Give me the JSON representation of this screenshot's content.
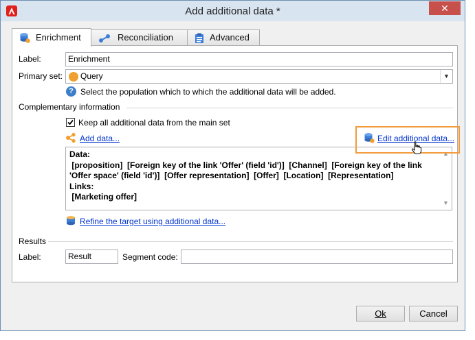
{
  "window": {
    "title": "Add additional data *",
    "close_label": "✕"
  },
  "tabs": [
    {
      "label": "Enrichment",
      "icon": "database-star-icon"
    },
    {
      "label": "Reconciliation",
      "icon": "link-nodes-icon"
    },
    {
      "label": "Advanced",
      "icon": "clipboard-icon"
    }
  ],
  "form": {
    "label_caption": "Label:",
    "label_value": "Enrichment",
    "primary_set_caption": "Primary set:",
    "primary_set_value": "Query",
    "help_text": "Select the population which to which the additional data will be added."
  },
  "complementary": {
    "section_title": "Complementary information",
    "keep_all_label": "Keep all additional data from the main set",
    "keep_all_checked": true,
    "add_data_link": "Add data...",
    "edit_data_link": "Edit additional data...",
    "data_lines": [
      "Data:",
      " [proposition]  [Foreign key of the link 'Offer' (field 'id')]  [Channel]  [Foreign key of the link 'Offer space' (field 'id')]  [Offer representation]  [Offer]  [Location]  [Representation]",
      "Links:",
      " [Marketing offer]"
    ],
    "refine_link": "Refine the target using additional data..."
  },
  "results": {
    "section_title": "Results",
    "label_caption": "Label:",
    "label_value": "Result",
    "segment_caption": "Segment code:",
    "segment_value": ""
  },
  "buttons": {
    "ok": "Ok",
    "cancel": "Cancel"
  },
  "colors": {
    "highlight": "#f29b3a",
    "link": "#0033cc",
    "close": "#c7504a"
  }
}
